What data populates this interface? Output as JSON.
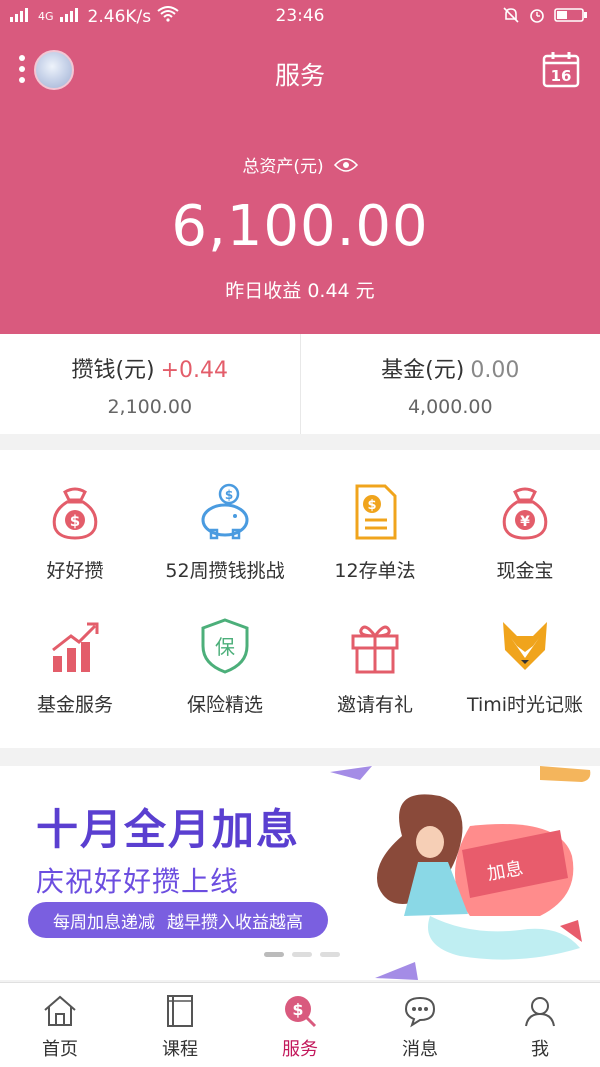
{
  "status_bar": {
    "signal_left": "2G",
    "network": "4G",
    "speed": "2.46K/s",
    "time": "23:46"
  },
  "header": {
    "title": "服务",
    "calendar_day": "16",
    "asset_label": "总资产(元)",
    "asset_value": "6,100.00",
    "yesterday_label": "昨日收益 0.44 元"
  },
  "accounts": [
    {
      "label": "攒钱(元)",
      "delta": "+0.44",
      "value": "2,100.00"
    },
    {
      "label": "基金(元)",
      "delta": "0.00",
      "value": "4,000.00"
    }
  ],
  "services": [
    {
      "label": "好好攒",
      "icon": "money-bag-dollar-icon"
    },
    {
      "label": "52周攒钱挑战",
      "icon": "piggy-bank-icon"
    },
    {
      "label": "12存单法",
      "icon": "document-dollar-icon"
    },
    {
      "label": "现金宝",
      "icon": "money-bag-yen-icon"
    },
    {
      "label": "基金服务",
      "icon": "growth-chart-icon"
    },
    {
      "label": "保险精选",
      "icon": "shield-bao-icon"
    },
    {
      "label": "邀请有礼",
      "icon": "gift-icon"
    },
    {
      "label": "Timi时光记账",
      "icon": "fox-icon"
    }
  ],
  "banner": {
    "headline": "十月全月加息",
    "subline": "庆祝好好攒上线",
    "pill_left": "每周加息递减",
    "pill_right": "越早攒入收益越高",
    "tag": "加息"
  },
  "tabs": [
    {
      "label": "首页",
      "icon": "home-icon"
    },
    {
      "label": "课程",
      "icon": "book-icon"
    },
    {
      "label": "服务",
      "icon": "service-icon"
    },
    {
      "label": "消息",
      "icon": "chat-icon"
    },
    {
      "label": "我",
      "icon": "user-icon"
    }
  ],
  "colors": {
    "brand": "#d95a7e",
    "active_tab": "#c2185b",
    "banner_purple": "#5a3fd0",
    "delta_red": "#e35d6a"
  }
}
